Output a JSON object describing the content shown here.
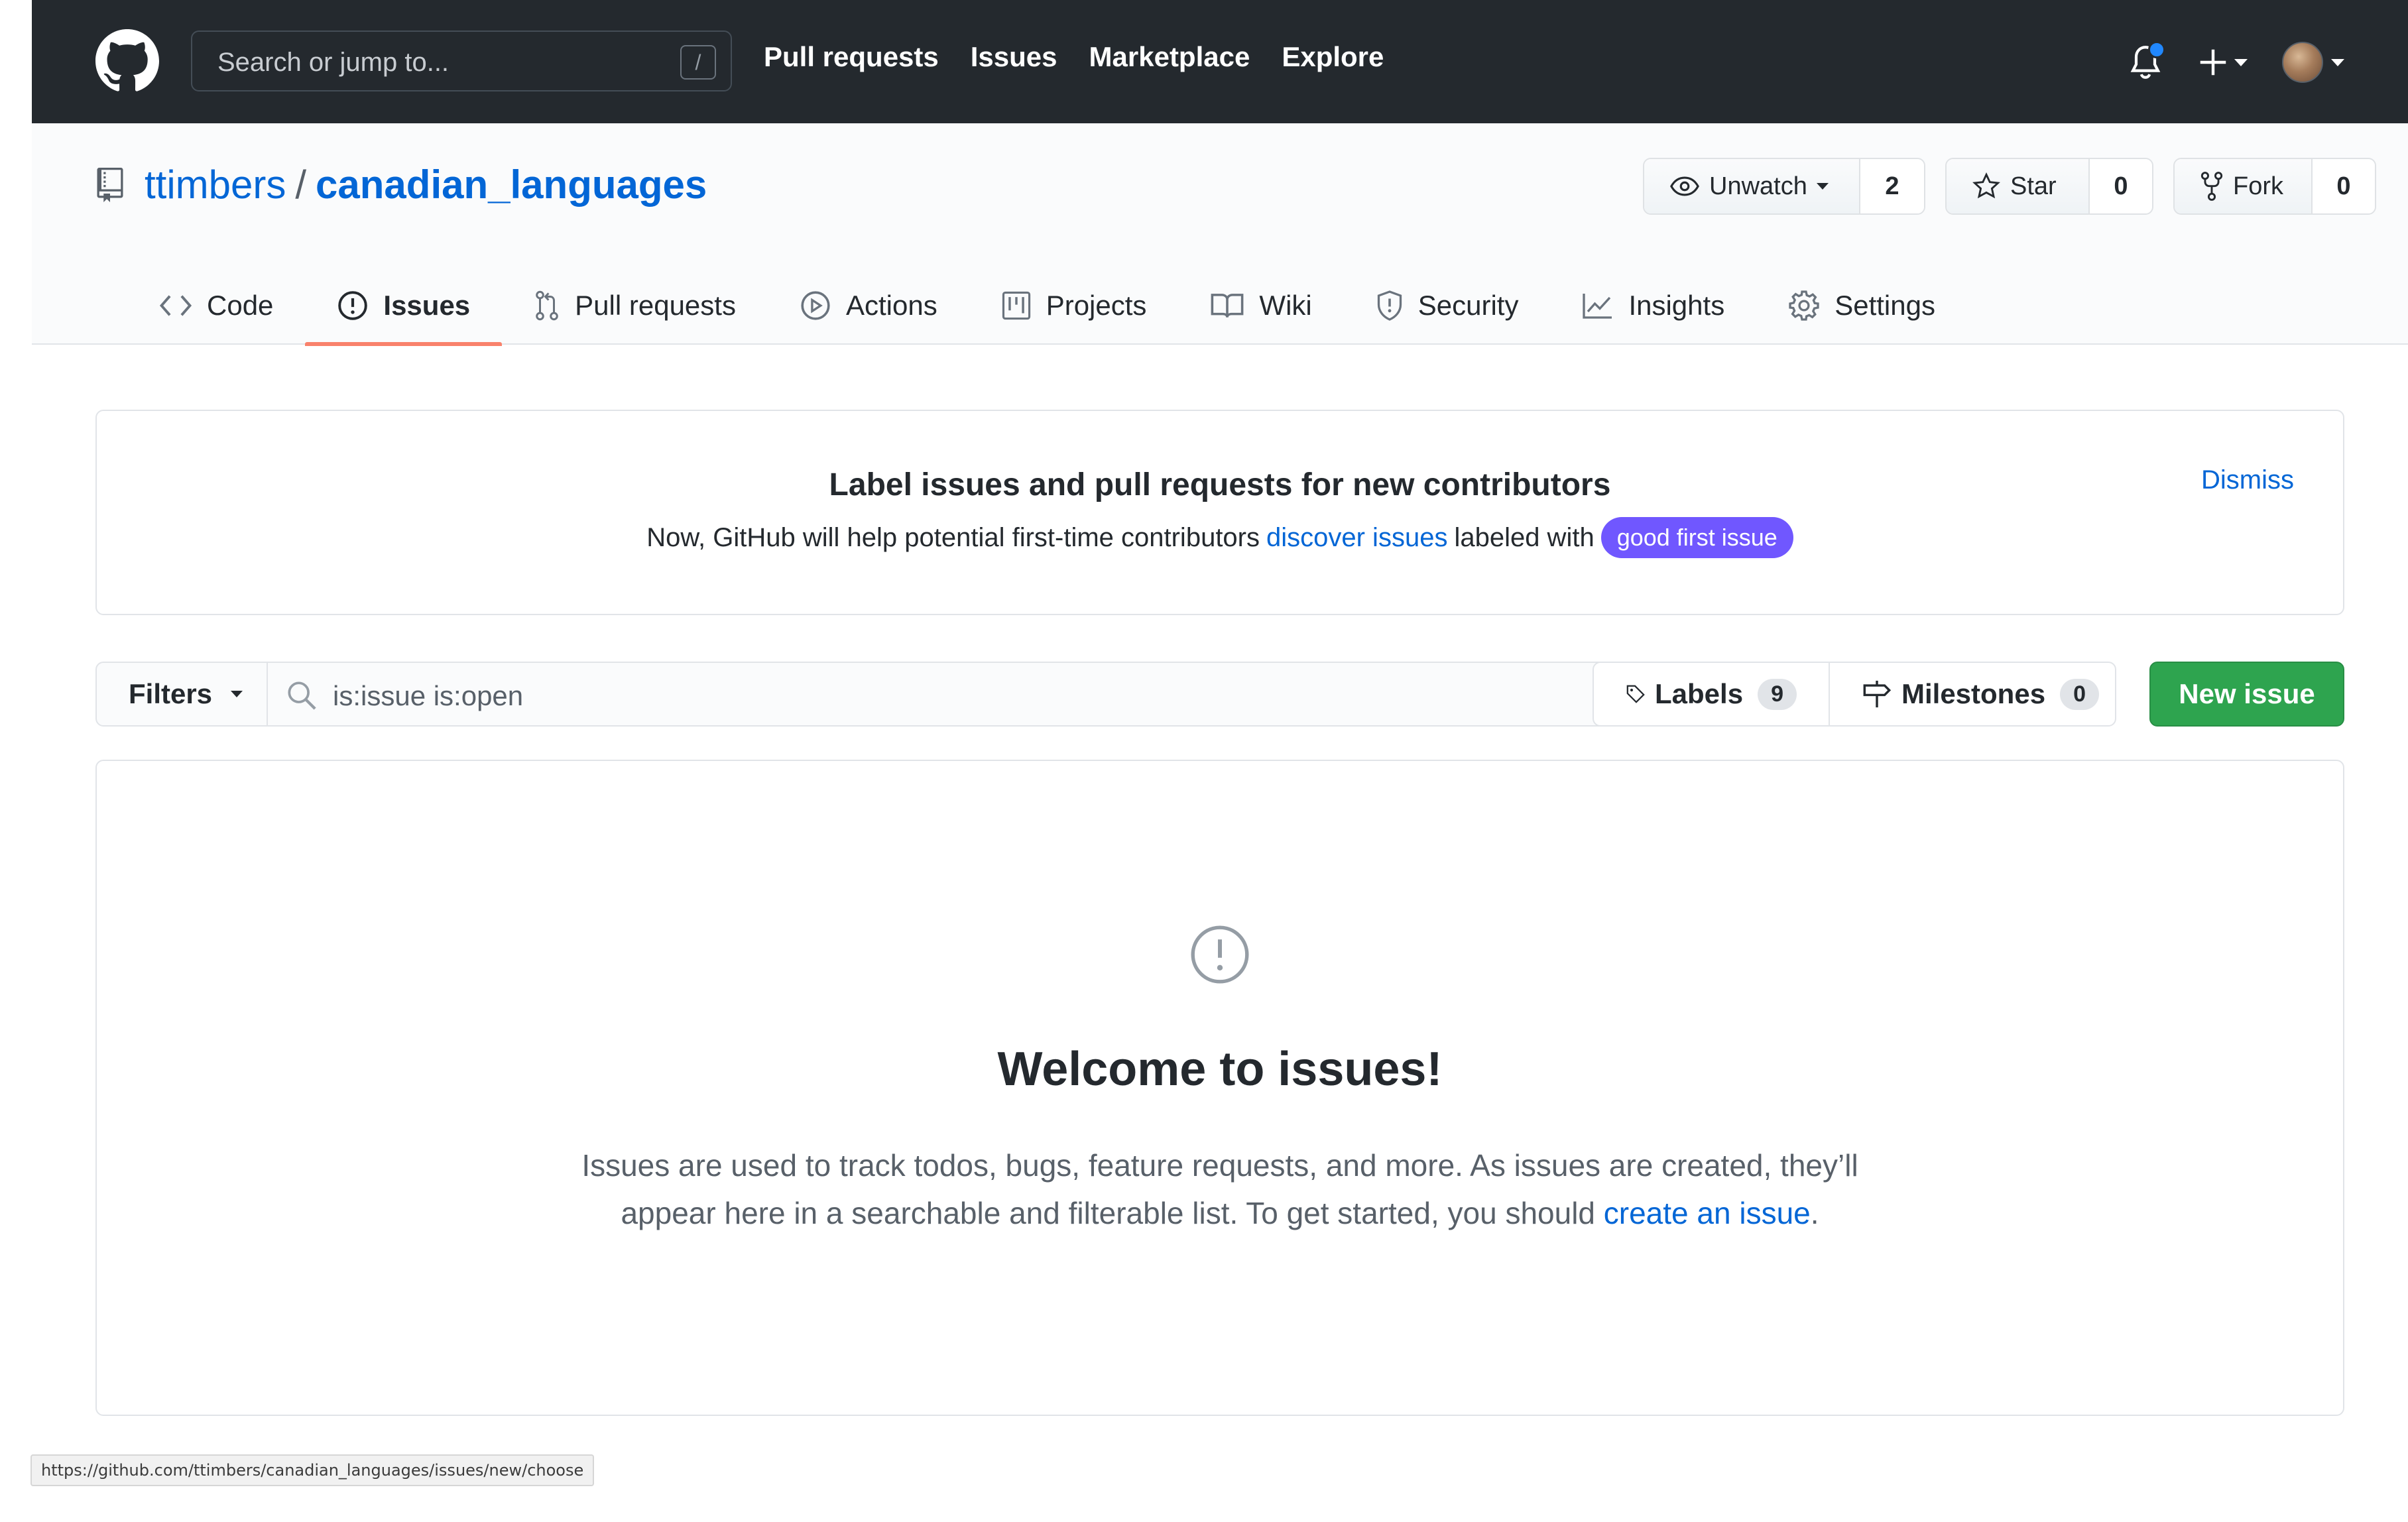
{
  "header": {
    "search_placeholder": "Search or jump to...",
    "search_shortcut": "/",
    "nav": [
      "Pull requests",
      "Issues",
      "Marketplace",
      "Explore"
    ]
  },
  "repo": {
    "owner": "ttimbers",
    "separator": "/",
    "name": "canadian_languages",
    "watch_label": "Unwatch",
    "watch_count": "2",
    "star_label": "Star",
    "star_count": "0",
    "fork_label": "Fork",
    "fork_count": "0"
  },
  "tabs": [
    {
      "label": "Code",
      "icon": "code-icon"
    },
    {
      "label": "Issues",
      "icon": "issue-icon",
      "active": true
    },
    {
      "label": "Pull requests",
      "icon": "pull-request-icon"
    },
    {
      "label": "Actions",
      "icon": "play-icon"
    },
    {
      "label": "Projects",
      "icon": "project-icon"
    },
    {
      "label": "Wiki",
      "icon": "book-icon"
    },
    {
      "label": "Security",
      "icon": "shield-icon"
    },
    {
      "label": "Insights",
      "icon": "graph-icon"
    },
    {
      "label": "Settings",
      "icon": "gear-icon"
    }
  ],
  "banner": {
    "title": "Label issues and pull requests for new contributors",
    "desc_before": "Now, GitHub will help potential first-time contributors",
    "desc_link": "discover issues",
    "desc_after": "labeled with",
    "label_pill": "good first issue",
    "dismiss": "Dismiss"
  },
  "filters": {
    "filters_label": "Filters",
    "query": "is:issue is:open",
    "labels_label": "Labels",
    "labels_count": "9",
    "milestones_label": "Milestones",
    "milestones_count": "0",
    "new_issue": "New issue"
  },
  "blankslate": {
    "heading": "Welcome to issues!",
    "text_before": "Issues are used to track todos, bugs, feature requests, and more. As issues are created, they’ll appear here in a searchable and filterable list. To get started, you should",
    "link": "create an issue",
    "text_after": "."
  },
  "status_url": "https://github.com/ttimbers/canadian_languages/issues/new/choose",
  "colors": {
    "header_bg": "#24292e",
    "link": "#0366d6",
    "active_tab_underline": "#f9826c",
    "good_first_issue": "#7057ff",
    "new_issue_green": "#2ea44f",
    "notification_dot": "#2188ff"
  }
}
